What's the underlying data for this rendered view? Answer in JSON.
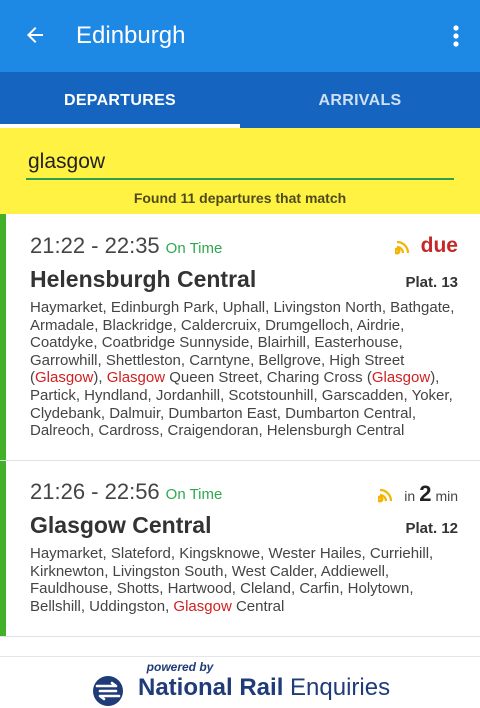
{
  "appbar": {
    "title": "Edinburgh"
  },
  "tabs": {
    "departures": "DEPARTURES",
    "arrivals": "ARRIVALS"
  },
  "filter": {
    "query": "glasgow",
    "match_text": "Found 11 departures that match"
  },
  "highlight": "Glasgow",
  "colors": {
    "appbar": "#1e88e5",
    "tabs": "#1565c0",
    "filter": "#fff242",
    "on_time": "#2fa84f",
    "highlight": "#d11f1f",
    "due": "#c62828",
    "left_bar": "#43b02a",
    "brand": "#1f3b78"
  },
  "departures": [
    {
      "times": "21:22 - 22:35",
      "status": "On Time",
      "eta_label": "due",
      "destination": "Helensburgh Central",
      "platform": "Plat. 13",
      "stops": "Haymarket, Edinburgh Park, Uphall, Livingston North, Bathgate, Armadale, Blackridge, Caldercruix, Drumgelloch, Airdrie, Coatdyke, Coatbridge Sunnyside, Blairhill, Easterhouse, Garrowhill, Shettleston, Carntyne, Bellgrove, High Street (Glasgow), Glasgow Queen Street, Charing Cross (Glasgow), Partick, Hyndland, Jordanhill, Scotstounhill, Garscadden, Yoker, Clydebank, Dalmuir, Dumbarton East, Dumbarton Central, Dalreoch, Cardross, Craigendoran, Helensburgh Central"
    },
    {
      "times": "21:26 - 22:56",
      "status": "On Time",
      "eta_prefix": "in",
      "eta_value": "2",
      "eta_unit": "min",
      "destination": "Glasgow Central",
      "platform": "Plat. 12",
      "stops": "Haymarket, Slateford, Kingsknowe, Wester Hailes, Curriehill, Kirknewton, Livingston South, West Calder, Addiewell, Fauldhouse, Shotts, Hartwood, Cleland, Carfin, Holytown, Bellshill, Uddingston, Glasgow Central"
    }
  ],
  "footer": {
    "powered_by": "powered by",
    "brand_bold": "National Rail",
    "brand_light": " Enquiries"
  }
}
